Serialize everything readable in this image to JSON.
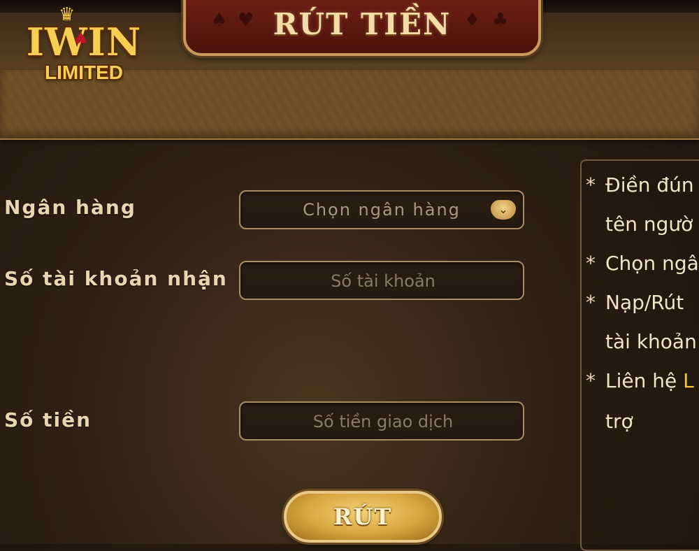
{
  "header": {
    "title": "RÚT TIỀN",
    "suits": [
      "♠",
      "♥",
      "♦",
      "♣"
    ]
  },
  "logo": {
    "top_text": "IWIN",
    "bottom_text": "LIMITED"
  },
  "form": {
    "bank_label": "Ngân hàng",
    "bank_select_placeholder": "Chọn ngân hàng",
    "account_label": "Số tài khoản nhận",
    "account_placeholder": "Số tài khoản",
    "amount_label": "Số tiền",
    "amount_placeholder": "Số tiền giao dịch",
    "submit_label": "RÚT"
  },
  "notes": {
    "line1": "Điền đún",
    "line2": "tên ngườ",
    "line3": "Chọn ngâ",
    "line4": "Nạp/Rút",
    "line5": "tài khoản",
    "line6_prefix": "Liên hệ",
    "line6_highlight": "L",
    "line7": "trợ"
  },
  "colors": {
    "accent_gold": "#f5c542",
    "title_red": "#6e1f14",
    "text_cream": "#e8d6b2"
  }
}
